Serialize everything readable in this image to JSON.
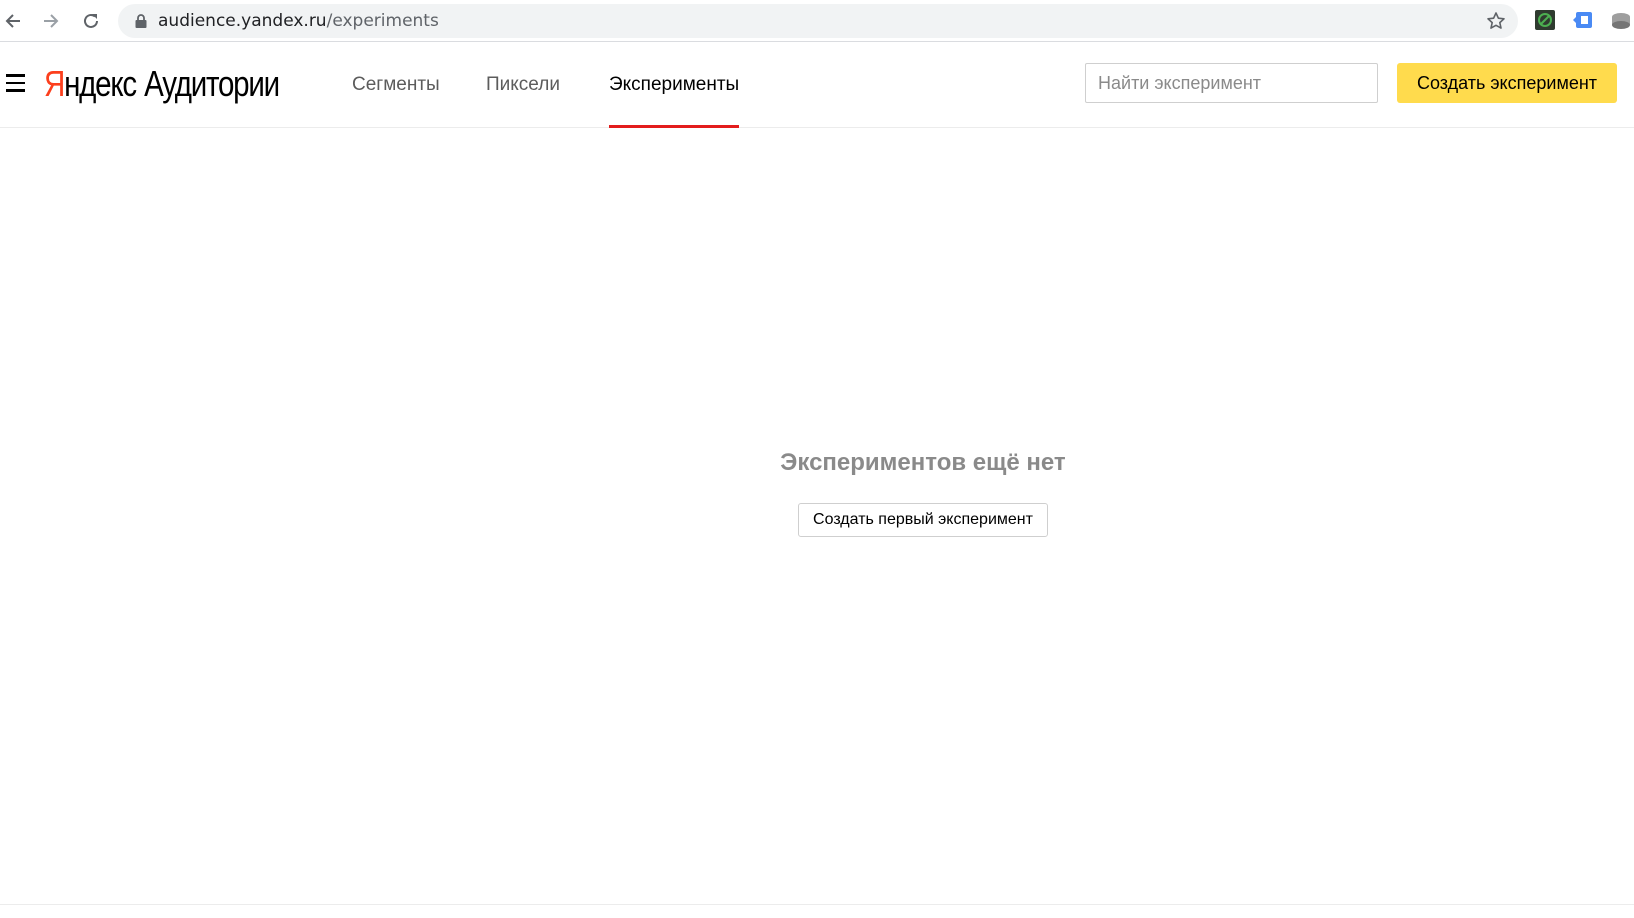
{
  "browser": {
    "url_host": "audience.yandex.ru",
    "url_path": "/experiments",
    "icons": [
      "back-arrow-icon",
      "forward-arrow-icon",
      "reload-icon",
      "lock-icon",
      "star-icon",
      "extension-icon"
    ]
  },
  "header": {
    "logo_brand_first": "Я",
    "logo_brand_rest": "ндекс",
    "logo_product": "Аудитории",
    "tabs": [
      {
        "label": "Сегменты",
        "active": false
      },
      {
        "label": "Пиксели",
        "active": false
      },
      {
        "label": "Эксперименты",
        "active": true
      }
    ],
    "search_placeholder": "Найти эксперимент",
    "create_button_label": "Создать эксперимент"
  },
  "main": {
    "empty_title": "Экспериментов ещё нет",
    "first_button_label": "Создать первый эксперимент"
  },
  "colors": {
    "brand_red": "#fc3f1d",
    "active_tab_underline": "#e31c1c",
    "primary_button": "#ffdb4d"
  }
}
